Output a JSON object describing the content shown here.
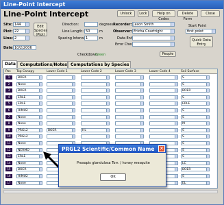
{
  "window": {
    "title": "Line-Point Intercept"
  },
  "header": {
    "title": "Line-Point Intercept"
  },
  "toolbar": {
    "unlock": "Unlock",
    "lock": "Lock",
    "help": "Help on Codes",
    "delete": "Delete Form",
    "close": "Close"
  },
  "form": {
    "site_label": "Site:",
    "site_value": "144",
    "plot_label": "Plot:",
    "plot_value": "22",
    "line_label": "Line:",
    "line_value": "2",
    "date_label": "Date:",
    "date_value": "10/2/2006",
    "edit_species_label": "Edit Species (Plot)",
    "direction_label": "Direction:",
    "direction_value": "",
    "degrees_label": "degrees",
    "line_length_label": "Line Length:",
    "line_length_value": "50",
    "line_length_unit": "m",
    "spacing_label": "Spacing Interval:",
    "spacing_value": "1",
    "spacing_unit": "m",
    "recorder_label": "Recorder:",
    "recorder_value": "Jason Smith",
    "observer_label": "Observer:",
    "observer_value": "Ericha Courtright",
    "data_entry_label": "Data Entry:",
    "data_entry_value": "",
    "error_check_label": "Error Check:",
    "error_check_value": "",
    "start_point_label": "Start Point",
    "start_point_value": "first point",
    "quick_entry_label": "Quick Data Entry",
    "checkdown_label": "Checkdown:",
    "checkdown_value": "Green",
    "people_label": "People"
  },
  "tabs": [
    {
      "label": "Data"
    },
    {
      "label": "Computations/Notes"
    },
    {
      "label": "Computations by Species"
    }
  ],
  "grid": {
    "headers": [
      "Pos",
      "Top Canopy",
      "Lower Code 1",
      "Lower Code 2",
      "Lower Code 3",
      "Lower Code 4",
      "Soil Surface"
    ],
    "rows": [
      {
        "pos": "1",
        "top": "BOER",
        "codes": [
          "",
          "",
          "",
          "",
          "S"
        ]
      },
      {
        "pos": "2",
        "top": "None",
        "codes": [
          "",
          "",
          "",
          "",
          "S"
        ]
      },
      {
        "pos": "3",
        "top": "BOER",
        "codes": [
          "",
          "",
          "",
          "",
          "BOER"
        ]
      },
      {
        "pos": "4",
        "top": "ERLE",
        "codes": [
          "",
          "",
          "",
          "",
          "S"
        ]
      },
      {
        "pos": "5",
        "top": "ERLE",
        "codes": [
          "",
          "",
          "",
          "",
          "ERLE"
        ]
      },
      {
        "pos": "6",
        "top": "HIMU2",
        "codes": [
          "",
          "",
          "",
          "",
          "S"
        ]
      },
      {
        "pos": "7",
        "top": "None",
        "codes": [
          "",
          "",
          "",
          "",
          "S"
        ]
      },
      {
        "pos": "8",
        "top": "None",
        "codes": [
          "",
          "",
          "",
          "",
          "M"
        ]
      },
      {
        "pos": "9",
        "top": "PRGL2",
        "codes": [
          "BOER",
          "HL",
          "",
          "",
          "S"
        ]
      },
      {
        "pos": "10",
        "top": "PRGL2",
        "codes": [
          "",
          "",
          "",
          "",
          "S"
        ]
      },
      {
        "pos": "11",
        "top": "None",
        "codes": [
          "",
          "",
          "",
          "",
          "S"
        ]
      },
      {
        "pos": "12",
        "top": "NERMO",
        "codes": [
          "",
          "",
          "",
          "",
          "S"
        ]
      },
      {
        "pos": "13",
        "top": "ERLE",
        "codes": [
          "",
          "",
          "",
          "",
          "S"
        ]
      },
      {
        "pos": "14",
        "top": "None",
        "codes": [
          "",
          "",
          "",
          "",
          "LC"
        ]
      },
      {
        "pos": "15",
        "top": "BOER",
        "codes": [
          "",
          "",
          "",
          "",
          "BOER"
        ]
      },
      {
        "pos": "16",
        "top": "HIMU2",
        "codes": [
          "",
          "",
          "",
          "",
          "S"
        ]
      },
      {
        "pos": "17",
        "top": "None",
        "codes": [
          "",
          "",
          "",
          "",
          "EL"
        ]
      }
    ]
  },
  "dialog": {
    "title": "PRGL2 Scientific/Common Name",
    "message": "Prosopis glandulosa Torr. / honey mesquite",
    "ok": "OK"
  }
}
